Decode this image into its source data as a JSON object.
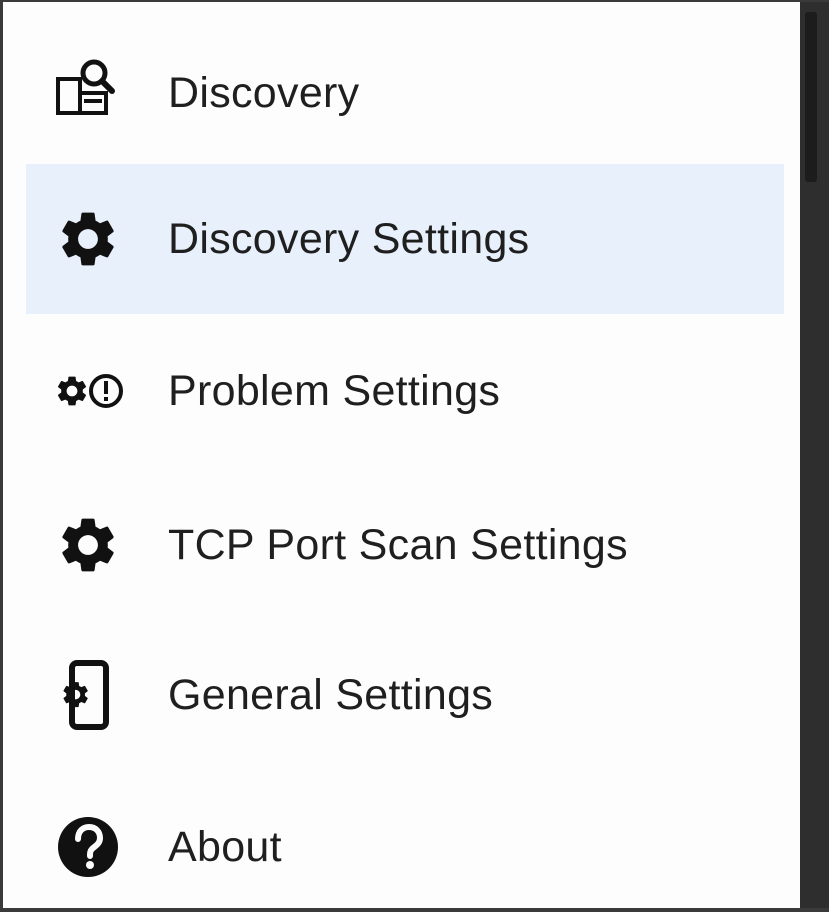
{
  "menu": {
    "items": [
      {
        "label": "Discovery",
        "icon": "discovery-search-icon",
        "selected": false
      },
      {
        "label": "Discovery Settings",
        "icon": "gear-icon",
        "selected": true
      },
      {
        "label": "Problem Settings",
        "icon": "gear-alert-icon",
        "selected": false
      },
      {
        "label": "TCP Port Scan Settings",
        "icon": "gear-icon",
        "selected": false
      },
      {
        "label": "General Settings",
        "icon": "phone-settings-icon",
        "selected": false
      },
      {
        "label": "About",
        "icon": "help-circle-icon",
        "selected": false
      }
    ]
  },
  "colors": {
    "selected_bg": "#e8f0fb",
    "text": "#1f1f1f",
    "icon": "#111111"
  }
}
